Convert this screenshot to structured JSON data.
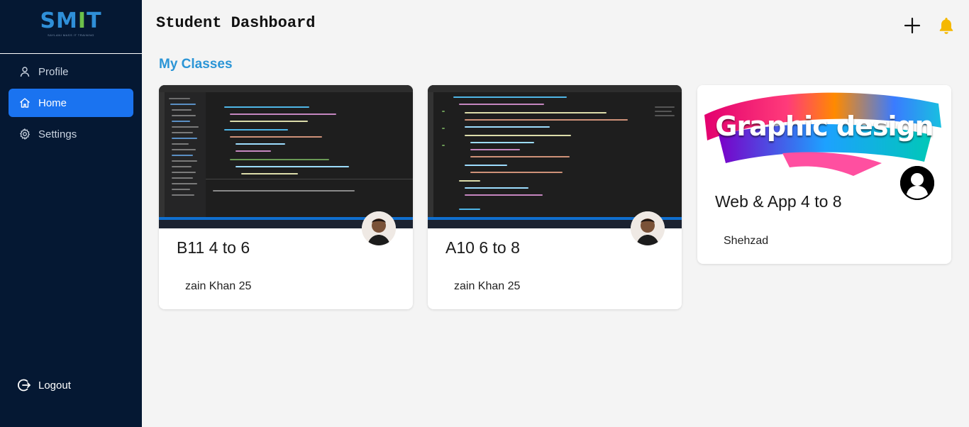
{
  "sidebar": {
    "logo": {
      "text_s": "S",
      "text_m": "M",
      "text_i": "I",
      "text_t": "T",
      "subtitle": "SAYLANI MASS IT TRAINING"
    },
    "items": [
      {
        "label": "Profile",
        "icon": "user-icon"
      },
      {
        "label": "Home",
        "icon": "home-icon",
        "active": true
      },
      {
        "label": "Settings",
        "icon": "gear-icon"
      }
    ],
    "logout_label": "Logout"
  },
  "header": {
    "title": "Student Dashboard",
    "add_icon": "plus-icon",
    "notification_icon": "bell-icon"
  },
  "section_title": "My Classes",
  "classes": [
    {
      "name": "B11 4 to 6",
      "teacher": "zain Khan 25",
      "thumbnail": "code-editor-screenshot"
    },
    {
      "name": "A10 6 to 8",
      "teacher": "zain Khan 25",
      "thumbnail": "code-editor-screenshot"
    },
    {
      "name": "Web & App 4 to 8",
      "teacher": "Shehzad",
      "thumbnail": "graphic-design-banner",
      "banner_text": "Graphic design"
    }
  ],
  "colors": {
    "sidebar_bg": "#051833",
    "active_nav": "#1a73f0",
    "section_title": "#2b95d6",
    "bell": "#f5b800",
    "page_bg": "#f4f4f4"
  }
}
